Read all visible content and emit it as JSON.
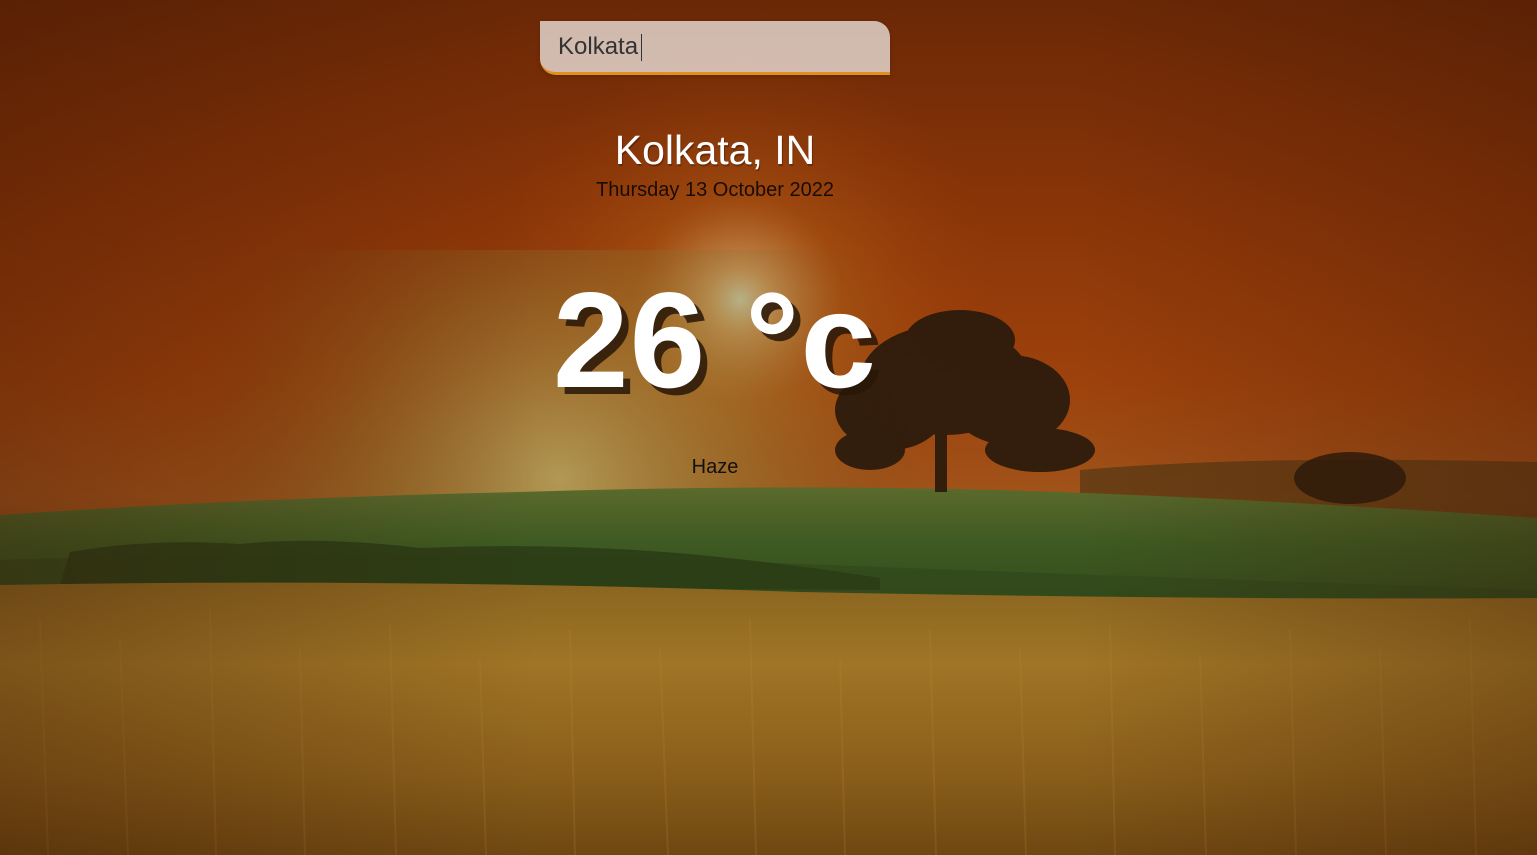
{
  "search": {
    "value": "Kolkata"
  },
  "weather": {
    "location": "Kolkata, IN",
    "date": "Thursday 13 October 2022",
    "temperature": "26 °c",
    "condition": "Haze"
  },
  "colors": {
    "sky_top": "#6b2a08",
    "sky_glow": "#b34a0c",
    "grass": "#3f5a24",
    "wheat": "#9a6a20",
    "search_underline": "#e0901f"
  },
  "icons": {
    "background": "sunset-field-image"
  }
}
